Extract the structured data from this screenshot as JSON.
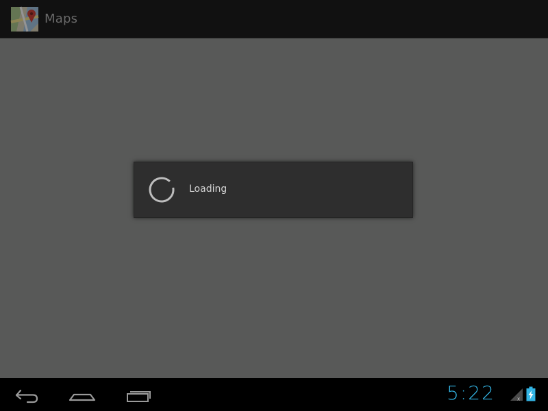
{
  "app": {
    "title": "Maps",
    "icon": "maps-app-icon"
  },
  "dialog": {
    "message": "Loading",
    "spinner_icon": "progress-spinner-icon"
  },
  "system_bar": {
    "nav": {
      "back_icon": "back-icon",
      "home_icon": "home-icon",
      "recent_icon": "recent-apps-icon"
    },
    "clock": "5:22",
    "signal_icon": "signal-no-service-icon",
    "battery_icon": "battery-charging-icon"
  },
  "colors": {
    "accent": "#33b5e5",
    "dim_background": "#585958",
    "dialog_background": "#2e2e2e",
    "action_bar": "#111111"
  }
}
